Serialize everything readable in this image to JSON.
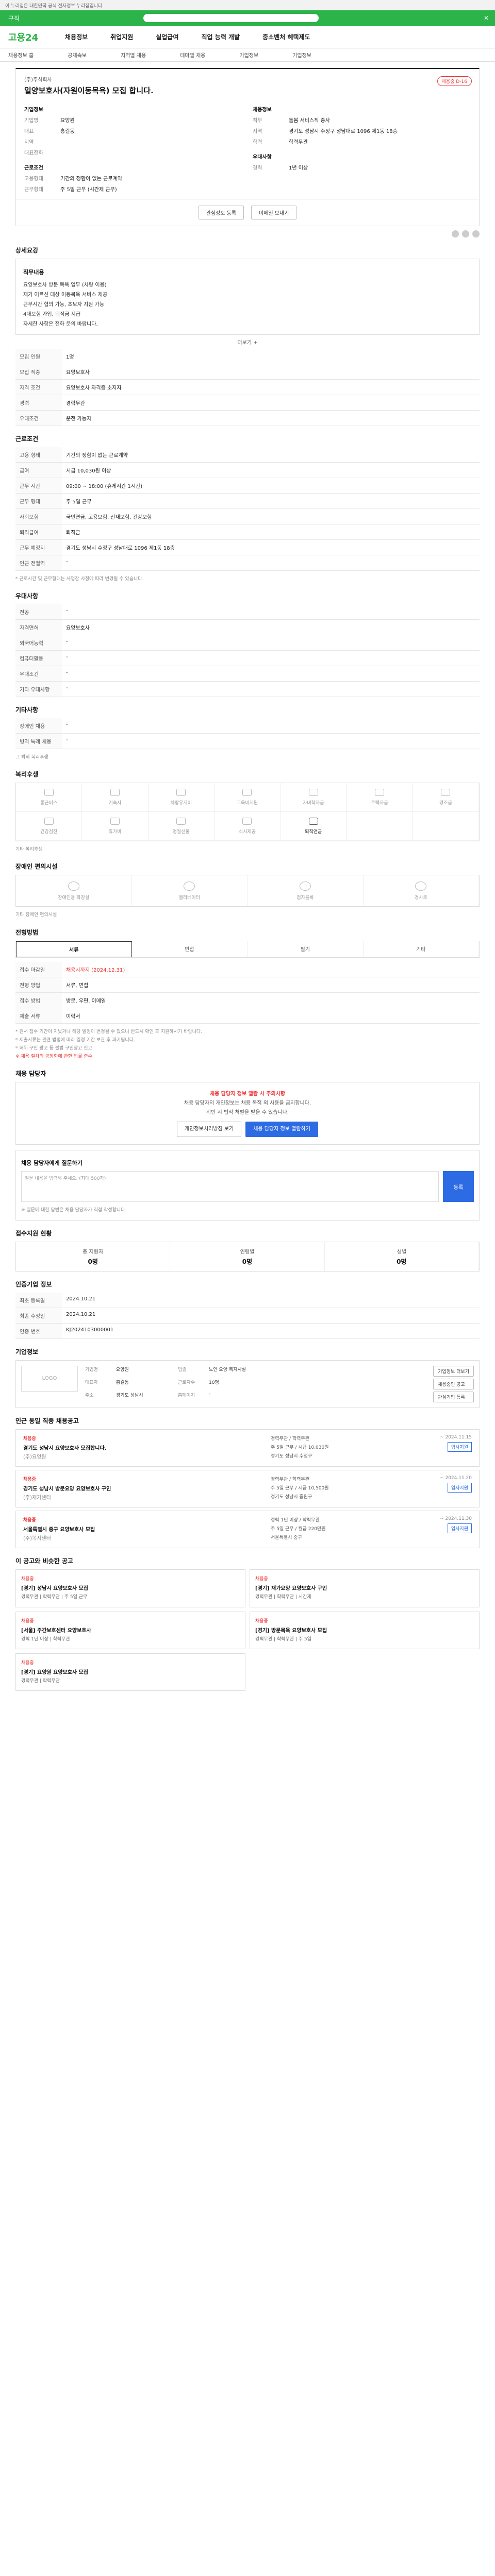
{
  "topbar": {
    "text": "이 누리집은 대한민국 공식 전자정부 누리집입니다."
  },
  "greenbar": {
    "label": "구직"
  },
  "logo": {
    "text": "고용24"
  },
  "gnb": [
    "채용정보",
    "취업지원",
    "실업급여",
    "직업 능력 개발",
    "중소벤처 혜택제도"
  ],
  "subnav": [
    "채용정보 홈",
    "공채속보",
    "지역별 채용",
    "테마별 채용",
    "기업정보",
    "기업정보"
  ],
  "job": {
    "company": "(주)주식회사",
    "title": "일양보호사(자원이동목욕) 모집 합니다.",
    "status_badge": "채용중 D-16",
    "company_group": "기업정보",
    "company_fields": [
      {
        "k": "기업명",
        "v": "요양원"
      },
      {
        "k": "대표",
        "v": "홍길동"
      },
      {
        "k": "지역",
        "v": ""
      },
      {
        "k": "대표전화",
        "v": ""
      }
    ],
    "recruit_group": "채용정보",
    "recruit_fields": [
      {
        "k": "직무",
        "v": "돌봄 서비스직 종사"
      },
      {
        "k": "지역",
        "v": "경기도 성남시 수정구 성남대로 1096 제1동 18층"
      },
      {
        "k": "학력",
        "v": "학력무관"
      }
    ],
    "work_group": "근로조건",
    "work_fields": [
      {
        "k": "고용형태",
        "v": "기간의 정함이 없는 근로계약"
      },
      {
        "k": "근무형태",
        "v": "주 5일 근무 (시간제 근무)"
      }
    ],
    "requirement_group": "우대사항",
    "requirement_fields": [
      {
        "k": "경력",
        "v": "1년 이상"
      }
    ]
  },
  "actions": {
    "scrap": "관심정보 등록",
    "share": "이메일 보내기"
  },
  "detail": {
    "title": "상세요강",
    "desc_title": "직무내용",
    "desc_lines": [
      "요양보호사 방문 목욕 업무 (차량 이용)",
      "재가 어르신 대상 이동목욕 서비스 제공",
      "근무시간 협의 가능, 초보자 지원 가능",
      "4대보험 가입, 퇴직금 지급",
      "자세한 사항은 전화 문의 바랍니다."
    ],
    "more": "더보기 +"
  },
  "recruit_rows": [
    {
      "k": "모집 인원",
      "v": "1명"
    },
    {
      "k": "모집 직종",
      "v": "요양보호사"
    },
    {
      "k": "자격 조건",
      "v": "요양보호사 자격증 소지자"
    },
    {
      "k": "경력",
      "v": "경력무관"
    },
    {
      "k": "우대조건",
      "v": "운전 가능자"
    }
  ],
  "conditions": {
    "title": "근로조건",
    "rows": [
      {
        "k": "고용 형태",
        "v": "기간의 정함이 없는 근로계약"
      },
      {
        "k": "급여",
        "v": "시급 10,030원 이상"
      },
      {
        "k": "근무 시간",
        "v": "09:00 ~ 18:00 (휴게시간 1시간)"
      },
      {
        "k": "근무 형태",
        "v": "주 5일 근무"
      },
      {
        "k": "사회보험",
        "v": "국민연금, 고용보험, 산재보험, 건강보험"
      },
      {
        "k": "퇴직급여",
        "v": "퇴직금"
      },
      {
        "k": "근무 예정지",
        "v": "경기도 성남시 수정구 성남대로 1096 제1동 18층"
      },
      {
        "k": "인근 전철역",
        "v": "-"
      }
    ],
    "note": "* 근로시간 및 근무형태는 사업장 사정에 따라 변경될 수 있습니다."
  },
  "preference": {
    "title": "우대사항",
    "rows": [
      {
        "k": "전공",
        "v": "-"
      },
      {
        "k": "자격면허",
        "v": "요양보호사"
      },
      {
        "k": "외국어능력",
        "v": "-"
      },
      {
        "k": "컴퓨터활용",
        "v": "-"
      },
      {
        "k": "우대조건",
        "v": "-"
      },
      {
        "k": "기타 우대사항",
        "v": "-"
      }
    ]
  },
  "other": {
    "title": "기타사항",
    "rows": [
      {
        "k": "장애인 채용",
        "v": "-"
      },
      {
        "k": "병역 특례 채용",
        "v": "-"
      }
    ],
    "extra_label": "그 밖의 복리후생"
  },
  "benefits": {
    "title": "복리후생",
    "items": [
      {
        "label": "통근버스",
        "on": false
      },
      {
        "label": "기숙사",
        "on": false
      },
      {
        "label": "차량유지비",
        "on": false
      },
      {
        "label": "교육비지원",
        "on": false
      },
      {
        "label": "자녀학자금",
        "on": false
      },
      {
        "label": "주택자금",
        "on": false
      },
      {
        "label": "경조금",
        "on": false
      },
      {
        "label": "건강검진",
        "on": false
      },
      {
        "label": "휴가비",
        "on": false
      },
      {
        "label": "명절선물",
        "on": false
      },
      {
        "label": "식사제공",
        "on": false
      },
      {
        "label": "퇴직연금",
        "on": true
      },
      {
        "label": "",
        "on": false
      },
      {
        "label": "",
        "on": false
      }
    ],
    "extra": "기타 복리후생"
  },
  "disability": {
    "title": "장애인 편의시설",
    "items": [
      "장애인용 화장실",
      "엘리베이터",
      "점자블록",
      "경사로"
    ],
    "extra": "기타 장애인 편의시설"
  },
  "apply": {
    "title": "전형방법",
    "tabs": [
      "서류",
      "면접",
      "필기",
      "기타"
    ],
    "rows": [
      {
        "k": "접수 마감일",
        "v": "채용시까지 (2024.12.31)"
      },
      {
        "k": "전형 방법",
        "v": "서류, 면접"
      },
      {
        "k": "접수 방법",
        "v": "방문, 우편, 이메일"
      },
      {
        "k": "제출 서류",
        "v": "이력서"
      }
    ],
    "notes": [
      "* 원서 접수 기간이 지났거나 해당 일정이 변경될 수 있으니 반드시 확인 후 지원하시기 바랍니다.",
      "* 제출서류는 관련 법령에 따라 일정 기간 보관 후 파기됩니다.",
      "* 허위 구인 광고 등 불법 구인광고 신고"
    ],
    "red_note": "※ 채용 절차의 공정화에 관한 법률 준수"
  },
  "contact": {
    "title": "채용 담당자",
    "warn": "채용 담당자 정보 열람 시 주의사항",
    "lines": [
      "채용 담당자의 개인정보는 채용 목적 외 사용을 금지합니다.",
      "위반 시 법적 처벌을 받을 수 있습니다."
    ],
    "btn1": "개인정보처리방침 보기",
    "btn2": "채용 담당자 정보 열람하기"
  },
  "qa": {
    "title": "채용 담당자에게 질문하기",
    "placeholder": "질문 내용을 입력해 주세요. (최대 500자)",
    "submit": "등록",
    "note": "※ 질문에 대한 답변은 채용 담당자가 직접 작성합니다."
  },
  "status": {
    "title": "접수지원 현황",
    "items": [
      {
        "label": "총 지원자",
        "value": "0명"
      },
      {
        "label": "연령별",
        "value": "0명"
      },
      {
        "label": "성별",
        "value": "0명"
      }
    ]
  },
  "info_table": {
    "title": "인증기업 정보",
    "rows": [
      {
        "k": "최초 등록일",
        "v": "2024.10.21"
      },
      {
        "k": "최종 수정일",
        "v": "2024.10.21"
      },
      {
        "k": "인증 번호",
        "v": "KJ2024103000001"
      }
    ]
  },
  "company": {
    "title": "기업정보",
    "logo_text": "LOGO",
    "fields": [
      {
        "k": "기업명",
        "v": "요양원"
      },
      {
        "k": "업종",
        "v": "노인 요양 복지시설"
      },
      {
        "k": "대표자",
        "v": "홍길동"
      },
      {
        "k": "근로자수",
        "v": "10명"
      },
      {
        "k": "주소",
        "v": "경기도 성남시"
      },
      {
        "k": "홈페이지",
        "v": "-"
      }
    ],
    "btns": [
      "기업정보 더보기",
      "채용중인 공고",
      "관심기업 등록"
    ]
  },
  "same_company": {
    "title": "인근 동일 직종 채용공고",
    "items": [
      {
        "badge": "채용중",
        "title": "경기도 성남시 요양보호사 모집합니다.",
        "company": "(주)요양원",
        "meta": [
          "경력무관 / 학력무관",
          "주 5일 근무 / 시급 10,030원",
          "경기도 성남시 수정구"
        ],
        "deadline": "~ 2024.11.15"
      },
      {
        "badge": "채용중",
        "title": "경기도 성남시 방문요양 요양보호사 구인",
        "company": "(주)재가센터",
        "meta": [
          "경력무관 / 학력무관",
          "주 5일 근무 / 시급 10,500원",
          "경기도 성남시 중원구"
        ],
        "deadline": "~ 2024.11.20"
      },
      {
        "badge": "채용중",
        "title": "서울특별시 중구 요양보호사 모집",
        "company": "(주)복지센터",
        "meta": [
          "경력 1년 이상 / 학력무관",
          "주 5일 근무 / 월급 220만원",
          "서울특별시 중구"
        ],
        "deadline": "~ 2024.11.30"
      }
    ],
    "apply_label": "입사지원"
  },
  "recommend": {
    "title": "이 공고와 비슷한 공고",
    "items": [
      {
        "tag": "채용중",
        "title": "[경기] 성남시 요양보호사 모집",
        "meta": "경력무관 | 학력무관 | 주 5일 근무"
      },
      {
        "tag": "채용중",
        "title": "[경기] 재가요양 요양보호사 구인",
        "meta": "경력무관 | 학력무관 | 시간제"
      },
      {
        "tag": "채용중",
        "title": "[서울] 주간보호센터 요양보호사",
        "meta": "경력 1년 이상 | 학력무관"
      },
      {
        "tag": "채용중",
        "title": "[경기] 방문목욕 요양보호사 모집",
        "meta": "경력무관 | 학력무관 | 주 5일"
      },
      {
        "tag": "채용중",
        "title": "[경기] 요양원 요양보호사 모집",
        "meta": "경력무관 | 학력무관"
      }
    ]
  },
  "colors": {
    "brand": "#2cb34a",
    "accent": "#2d6be4",
    "alert": "#e33333"
  }
}
